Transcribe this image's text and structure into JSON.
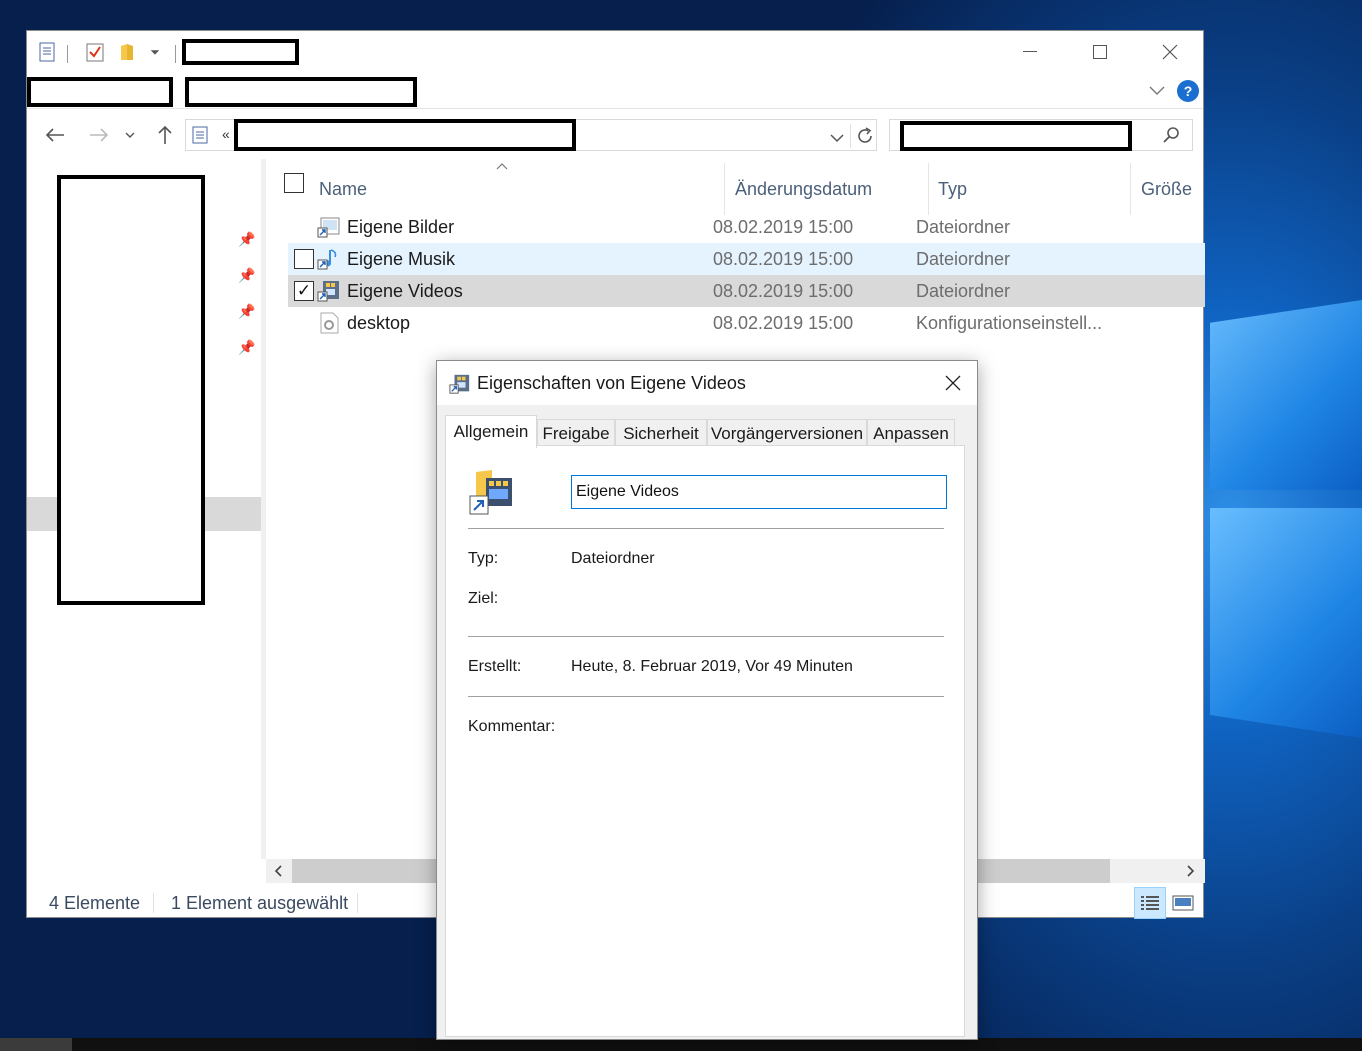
{
  "explorer": {
    "columns": {
      "name": "Name",
      "date": "Änderungsdatum",
      "type": "Typ",
      "size": "Größe"
    },
    "files": [
      {
        "name": "Eigene Bilder",
        "date": "08.02.2019 15:00",
        "type": "Dateiordner",
        "icon": "pictures-shortcut-icon"
      },
      {
        "name": "Eigene Musik",
        "date": "08.02.2019 15:00",
        "type": "Dateiordner",
        "icon": "music-shortcut-icon"
      },
      {
        "name": "Eigene Videos",
        "date": "08.02.2019 15:00",
        "type": "Dateiordner",
        "icon": "videos-shortcut-icon"
      },
      {
        "name": "desktop",
        "date": "08.02.2019 15:00",
        "type": "Konfigurationseinstell...",
        "icon": "settings-file-icon"
      }
    ],
    "address_prefix": "«",
    "status": {
      "count": "4 Elemente",
      "selection": "1 Element ausgewählt"
    }
  },
  "dialog": {
    "title": "Eigenschaften von Eigene Videos",
    "tabs": [
      "Allgemein",
      "Freigabe",
      "Sicherheit",
      "Vorgängerversionen",
      "Anpassen"
    ],
    "active_tab": "Allgemein",
    "name_value": "Eigene Videos",
    "fields": {
      "type_label": "Typ:",
      "type_value": "Dateiordner",
      "target_label": "Ziel:",
      "target_value": "",
      "created_label": "Erstellt:",
      "created_value": "Heute, 8. Februar 2019, Vor 49 Minuten",
      "comment_label": "Kommentar:"
    }
  },
  "colors": {
    "accent": "#0078d7",
    "hover_row": "#e5f3ff",
    "selected_row": "#d9d9d9",
    "help": "#1a6fd1"
  }
}
